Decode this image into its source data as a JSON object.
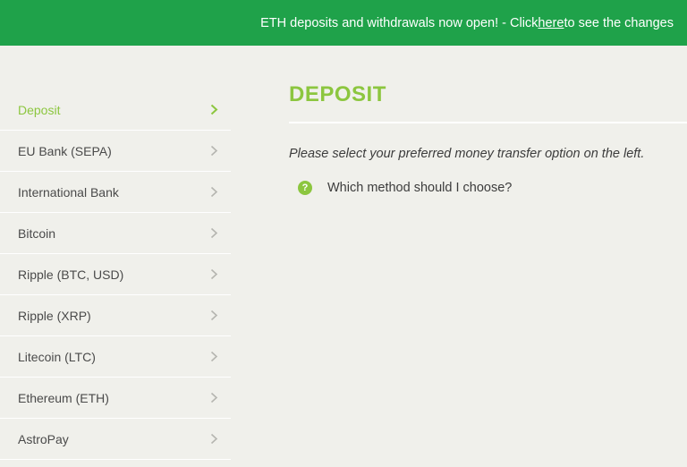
{
  "banner": {
    "text_before": "ETH deposits and withdrawals now open! - Click ",
    "link": "here",
    "text_after": " to see the changes"
  },
  "sidebar": {
    "items": [
      {
        "label": "Deposit",
        "active": true
      },
      {
        "label": "EU Bank (SEPA)"
      },
      {
        "label": "International Bank"
      },
      {
        "label": "Bitcoin"
      },
      {
        "label": "Ripple (BTC, USD)"
      },
      {
        "label": "Ripple (XRP)"
      },
      {
        "label": "Litecoin (LTC)"
      },
      {
        "label": "Ethereum (ETH)"
      },
      {
        "label": "AstroPay"
      }
    ]
  },
  "main": {
    "title": "DEPOSIT",
    "intro": "Please select your preferred money transfer option on the left.",
    "help_icon_glyph": "?",
    "help_link": "Which method should I choose?"
  },
  "colors": {
    "banner_bg": "#1fa24a",
    "accent": "#8cc63f",
    "page_bg": "#f0f0eb"
  }
}
